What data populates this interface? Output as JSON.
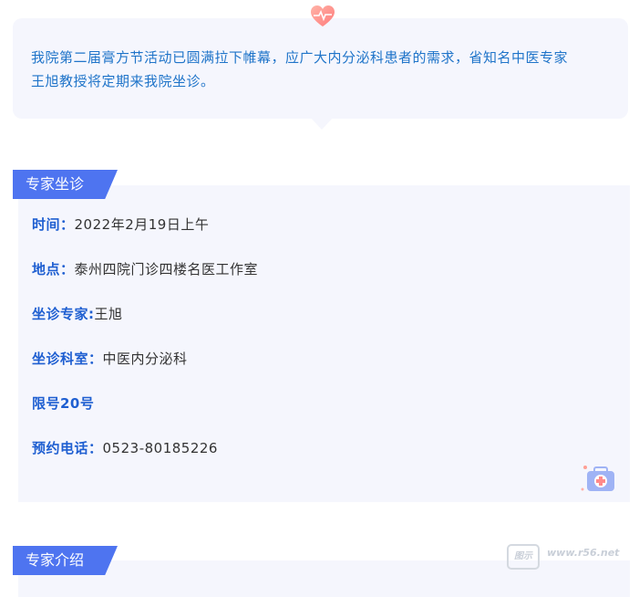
{
  "intro": {
    "text_line1": "我院第二届膏方节活动已圆满拉下帷幕，应广大内分泌科患者的需求，省知名中医专家",
    "text_line2": "王旭教授将定期来我院坐诊。"
  },
  "section1": {
    "tag": "专家坐诊",
    "rows": [
      {
        "label": "时间：",
        "value": "2022年2月19日上午"
      },
      {
        "label": "地点：",
        "value": "泰州四院门诊四楼名医工作室"
      },
      {
        "label": "坐诊专家:",
        "value": "王旭"
      },
      {
        "label": "坐诊科室：",
        "value": "中医内分泌科"
      },
      {
        "label": "限号20号",
        "value": ""
      },
      {
        "label": "预约电话：",
        "value": "0523-80185226"
      }
    ]
  },
  "section2": {
    "tag": "专家介绍"
  },
  "watermark": {
    "box": "图示",
    "text": "www.r56.net"
  },
  "icons": {
    "heart": "heart-pulse-icon",
    "kit": "medical-kit-icon"
  },
  "colors": {
    "accent": "#4e74f0",
    "label": "#1f5fd1",
    "intro_text": "#1f74c9",
    "card_bg": "#f5f6fd"
  }
}
